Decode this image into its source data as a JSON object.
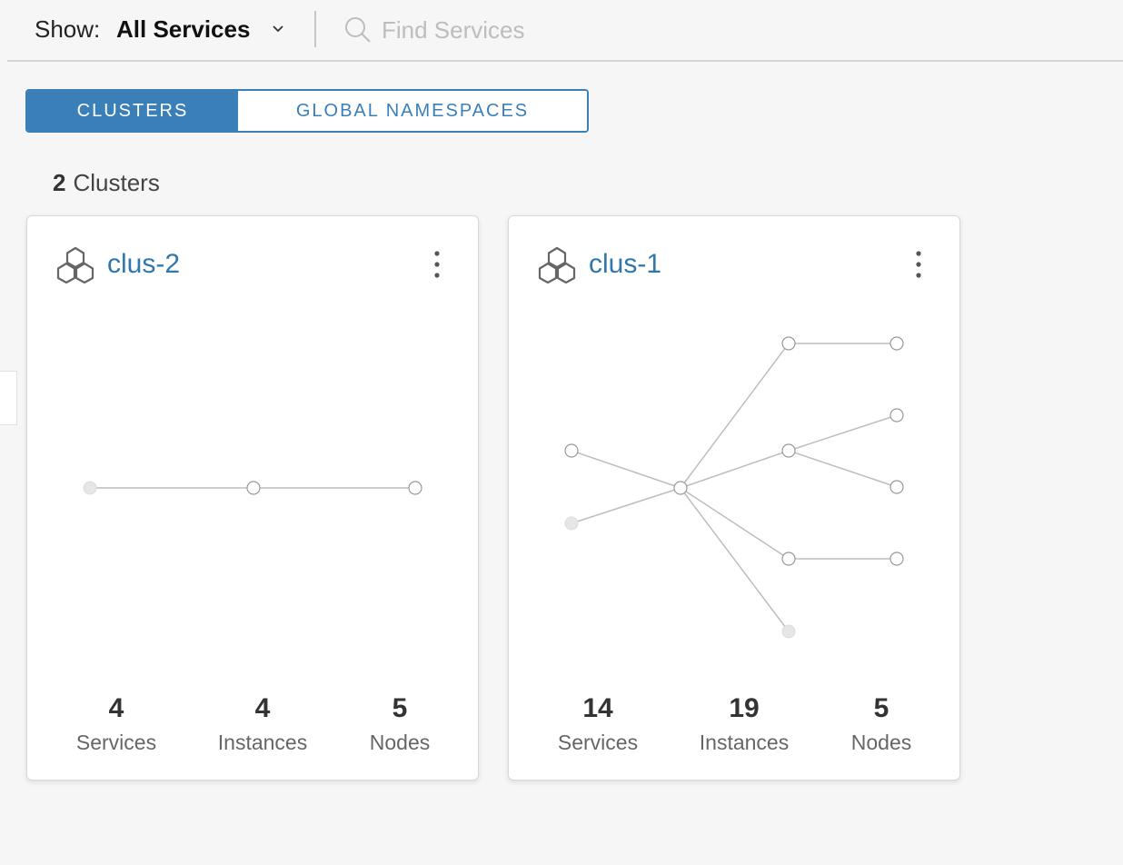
{
  "toolbar": {
    "show_label": "Show:",
    "show_value": "All Services",
    "search_placeholder": "Find Services"
  },
  "tabs": [
    {
      "label": "CLUSTERS",
      "active": true
    },
    {
      "label": "GLOBAL NAMESPACES",
      "active": false
    }
  ],
  "summary": {
    "count": "2",
    "label": "Clusters"
  },
  "colors": {
    "accent": "#3a7fb8",
    "link": "#2f77ad"
  },
  "clusters": [
    {
      "name": "clus-2",
      "icon": "hexagon-cluster-icon",
      "stats": [
        {
          "value": "4",
          "label": "Services"
        },
        {
          "value": "4",
          "label": "Instances"
        },
        {
          "value": "5",
          "label": "Nodes"
        }
      ]
    },
    {
      "name": "clus-1",
      "icon": "hexagon-cluster-icon",
      "stats": [
        {
          "value": "14",
          "label": "Services"
        },
        {
          "value": "19",
          "label": "Instances"
        },
        {
          "value": "5",
          "label": "Nodes"
        }
      ]
    }
  ]
}
